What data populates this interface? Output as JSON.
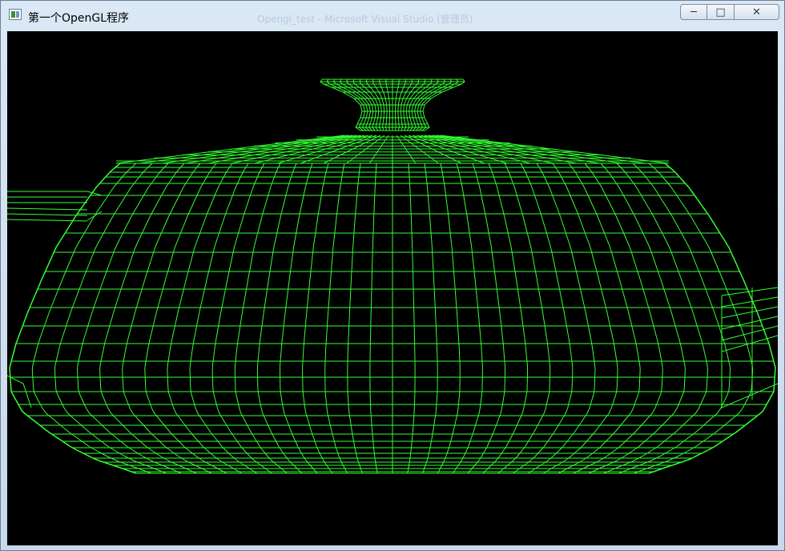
{
  "window": {
    "title": "第一个OpenGL程序",
    "background_title": "Opengl_test - Microsoft Visual Studio (管理员)"
  },
  "controls": {
    "minimize_icon": "minimize-icon",
    "maximize_icon": "maximize-icon",
    "close_icon": "close-icon"
  },
  "scene": {
    "object": "teapot-wireframe",
    "background_color": "#000000",
    "wire_color": "#33ff33"
  }
}
